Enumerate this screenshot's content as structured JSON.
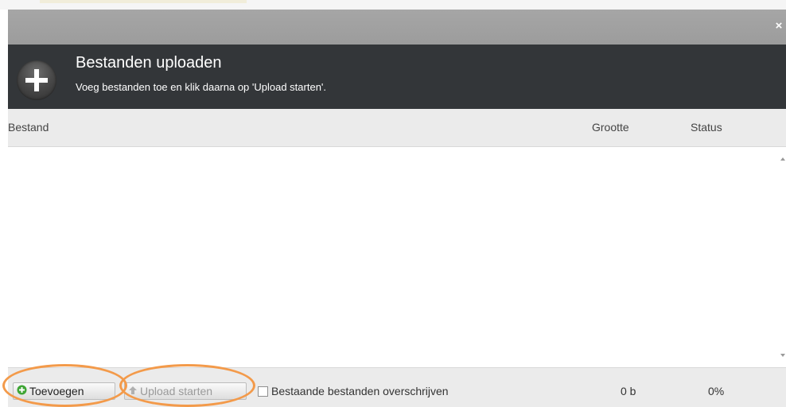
{
  "dialog": {
    "title": "Bestanden uploaden",
    "subtitle": "Voeg bestanden toe en klik daarna op 'Upload starten'.",
    "close_icon": "×"
  },
  "columns": {
    "file": "Bestand",
    "size": "Grootte",
    "status": "Status"
  },
  "footer": {
    "add_label": "Toevoegen",
    "start_label": "Upload starten",
    "overwrite_label": "Bestaande bestanden overschrijven",
    "overwrite_checked": false,
    "total_size": "0 b",
    "total_status": "0%"
  },
  "icons": {
    "header": "plus-icon",
    "add": "add-circle-icon",
    "start": "up-arrow-icon",
    "close": "close-icon"
  },
  "colors": {
    "header_bg": "#333639",
    "titlebar_bg": "#a0a0a0",
    "highlight": "#f39a4a",
    "add_icon": "#3fa535"
  }
}
